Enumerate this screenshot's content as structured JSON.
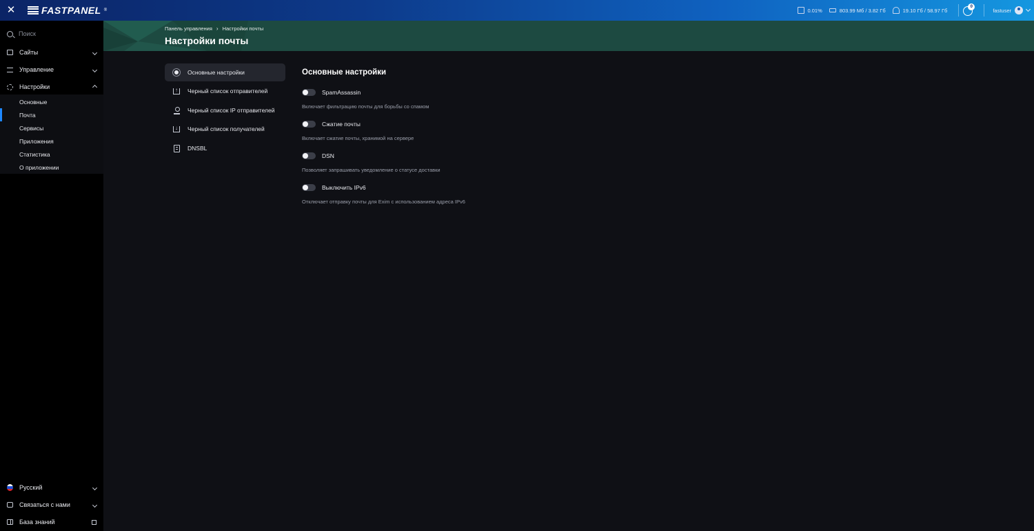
{
  "topbar": {
    "logo_text": "FASTPANEL",
    "logo_reg": "®",
    "cpu": "0.01%",
    "memory": "803.99 Мб / 3.82 Гб",
    "disk": "19.10 Гб / 58.97 Гб",
    "notifications_count": "0",
    "username": "fastuser"
  },
  "sidebar": {
    "search_placeholder": "Поиск",
    "items": [
      {
        "label": "Сайты",
        "icon": "window-icon"
      },
      {
        "label": "Управление",
        "icon": "sliders-icon"
      },
      {
        "label": "Настройки",
        "icon": "gear-icon"
      }
    ],
    "sub_items": [
      {
        "label": "Основные",
        "active": false
      },
      {
        "label": "Почта",
        "active": true
      },
      {
        "label": "Сервисы",
        "active": false
      },
      {
        "label": "Приложения",
        "active": false
      },
      {
        "label": "Статистика",
        "active": false
      },
      {
        "label": "О приложении",
        "active": false
      }
    ],
    "bottom": {
      "language": "Русский",
      "contact": "Связаться с нами",
      "knowledge_base": "База знаний"
    }
  },
  "header": {
    "breadcrumb": [
      "Панель управления",
      "Настройки почты"
    ],
    "title": "Настройки почты"
  },
  "menu": [
    {
      "label": "Основные настройки",
      "icon": "circle-dot-icon",
      "active": true
    },
    {
      "label": "Черный список отправителей",
      "icon": "upload-icon",
      "active": false
    },
    {
      "label": "Черный список IP отправителей",
      "icon": "ip-pin-icon",
      "active": false
    },
    {
      "label": "Черный список получателей",
      "icon": "download-icon",
      "active": false
    },
    {
      "label": "DNSBL",
      "icon": "list-icon",
      "active": false
    }
  ],
  "content": {
    "title": "Основные настройки",
    "settings": [
      {
        "label": "SpamAssassin",
        "description": "Включает фильтрацию почты для борьбы со спамом",
        "enabled": false
      },
      {
        "label": "Сжатие почты",
        "description": "Включает сжатие почты, хранимой на сервере",
        "enabled": false
      },
      {
        "label": "DSN",
        "description": "Позволяет запрашивать уведомление о статусе доставки",
        "enabled": false
      },
      {
        "label": "Выключить IPv6",
        "description": "Отключает отправку почты для Exim с использованием адреса IPv6",
        "enabled": false
      }
    ]
  },
  "colors": {
    "accent": "#1e88ff",
    "header_band": "#1d4a41",
    "background": "#0f1015",
    "sidebar": "#000000"
  }
}
